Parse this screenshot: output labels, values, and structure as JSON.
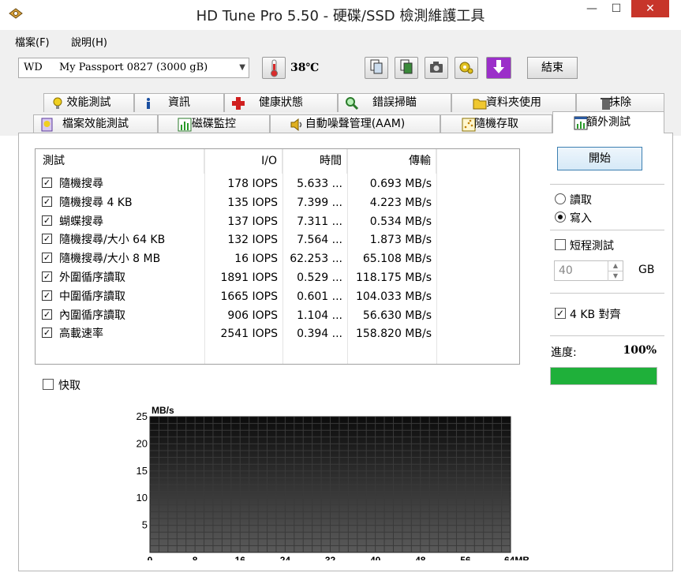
{
  "window": {
    "title": "HD Tune Pro 5.50 - 硬碟/SSD 檢測維護工具",
    "min_glyph": "—",
    "max_glyph": "☐",
    "close_glyph": "✕"
  },
  "menu": {
    "file": "檔案(F)",
    "help": "說明(H)"
  },
  "toolbar": {
    "drive_brand": "WD",
    "drive_name": "My Passport 0827 (3000 gB)",
    "temperature": "38℃",
    "exit_label": "結束",
    "icons": [
      "copy-icon",
      "copy-text-icon",
      "camera-icon",
      "options-icon",
      "save-download-icon"
    ]
  },
  "tabs": {
    "row1": [
      "效能測試",
      "資訊",
      "健康狀態",
      "錯誤掃瞄",
      "資料夾使用",
      "抹除"
    ],
    "row2": [
      "檔案效能測試",
      "磁碟監控",
      "自動噪聲管理(AAM)",
      "隨機存取",
      "額外測試"
    ]
  },
  "table": {
    "headers": [
      "測試",
      "I/O",
      "時間",
      "傳輸"
    ],
    "rows": [
      {
        "name": "隨機搜尋",
        "io": "178 IOPS",
        "time": "5.633 ...",
        "rate": "0.693 MB/s"
      },
      {
        "name": "隨機搜尋 4 KB",
        "io": "135 IOPS",
        "time": "7.399 ...",
        "rate": "4.223 MB/s"
      },
      {
        "name": "蝴蝶搜尋",
        "io": "137 IOPS",
        "time": "7.311 ...",
        "rate": "0.534 MB/s"
      },
      {
        "name": "隨機搜尋/大小 64 KB",
        "io": "132 IOPS",
        "time": "7.564 ...",
        "rate": "1.873 MB/s"
      },
      {
        "name": "隨機搜尋/大小 8 MB",
        "io": "16 IOPS",
        "time": "62.253 ...",
        "rate": "65.108 MB/s"
      },
      {
        "name": "外圍循序讀取",
        "io": "1891 IOPS",
        "time": "0.529 ...",
        "rate": "118.175 MB/s"
      },
      {
        "name": "中圍循序讀取",
        "io": "1665 IOPS",
        "time": "0.601 ...",
        "rate": "104.033 MB/s"
      },
      {
        "name": "內圍循序讀取",
        "io": "906 IOPS",
        "time": "1.104 ...",
        "rate": "56.630 MB/s"
      },
      {
        "name": "高載速率",
        "io": "2541 IOPS",
        "time": "0.394 ...",
        "rate": "158.820 MB/s"
      }
    ]
  },
  "cache": {
    "label": "快取",
    "checked": false
  },
  "side": {
    "start_label": "開始",
    "read_label": "讀取",
    "write_label": "寫入",
    "selected_mode": "write",
    "short_test_label": "短程測試",
    "short_test_checked": false,
    "gb_value": "40",
    "gb_unit": "GB",
    "align_label": "4 KB 對齊",
    "align_checked": true,
    "progress_label": "進度:",
    "progress_value": "100%",
    "progress_fraction": 1.0,
    "progress_color": "#1fb03a"
  },
  "chart_data": {
    "type": "line",
    "ylabel": "MB/s",
    "ylim": [
      0,
      25
    ],
    "y_ticks": [
      "25",
      "20",
      "15",
      "10",
      "5"
    ],
    "xlim": [
      0,
      64
    ],
    "x_ticks": [
      "0",
      "8",
      "16",
      "24",
      "32",
      "40",
      "48",
      "56",
      "64MB"
    ],
    "series": [],
    "grid": true
  }
}
